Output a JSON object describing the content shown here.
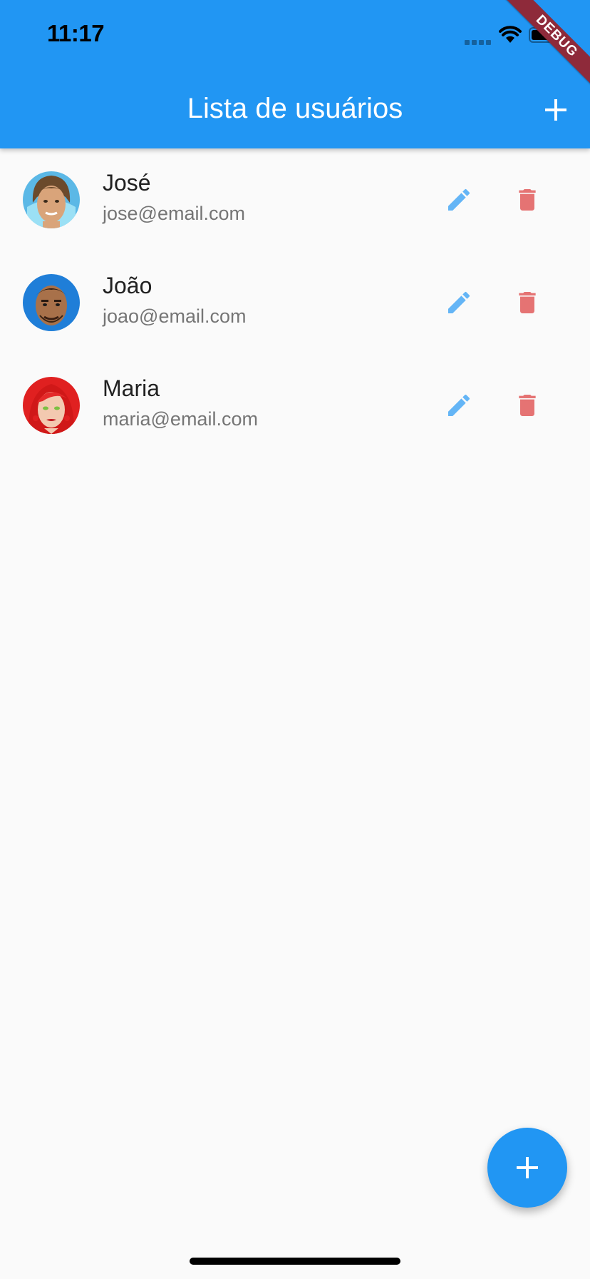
{
  "status_bar": {
    "time": "11:17"
  },
  "debug_banner": "DEBUG",
  "app_bar": {
    "title": "Lista de usuários",
    "action_icon": "plus-icon"
  },
  "users": [
    {
      "name": "José",
      "email": "jose@email.com",
      "avatar": "avatar-jose"
    },
    {
      "name": "João",
      "email": "joao@email.com",
      "avatar": "avatar-joao"
    },
    {
      "name": "Maria",
      "email": "maria@email.com",
      "avatar": "avatar-maria"
    }
  ],
  "row_actions": {
    "edit_icon": "pencil-icon",
    "delete_icon": "trash-icon"
  },
  "fab": {
    "icon": "plus-icon"
  },
  "colors": {
    "primary": "#2196f3",
    "edit": "#64b5f6",
    "delete": "#e57373",
    "background": "#fafafa"
  }
}
